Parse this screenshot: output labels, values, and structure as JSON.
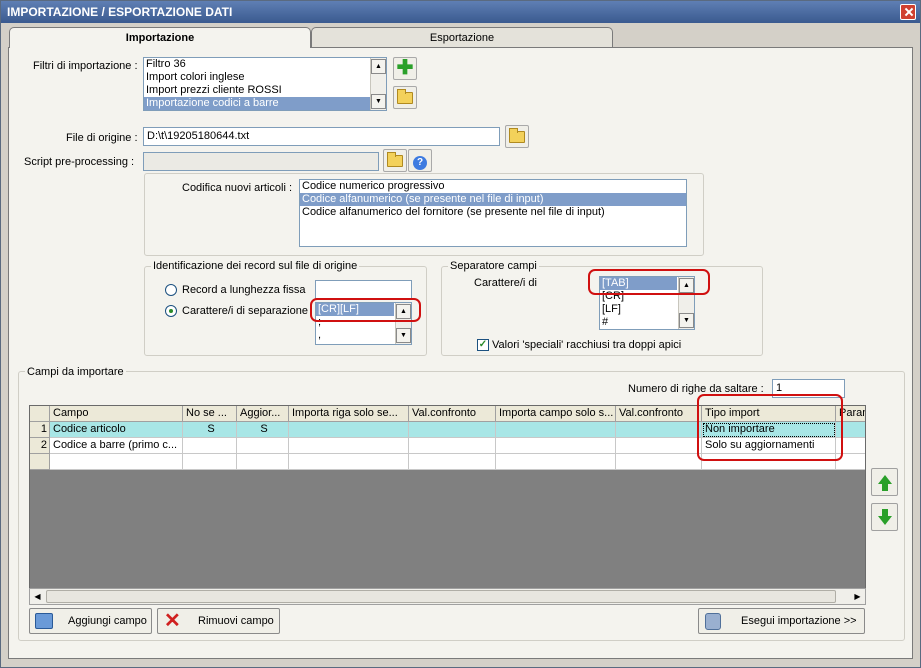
{
  "window": {
    "title": "IMPORTAZIONE / ESPORTAZIONE DATI"
  },
  "tabs": [
    {
      "label": "Importazione",
      "active": true
    },
    {
      "label": "Esportazione",
      "active": false
    }
  ],
  "filters": {
    "label": "Filtri di importazione :",
    "items": [
      "Filtro 36",
      "Import colori inglese",
      "Import prezzi cliente ROSSI",
      "Importazione codici a barre"
    ],
    "selected_index": 3
  },
  "source_file": {
    "label": "File di origine :",
    "value": "D:\\t\\19205180644.txt"
  },
  "script": {
    "label": "Script pre-processing :",
    "value": ""
  },
  "codifica": {
    "label": "Codifica nuovi articoli :",
    "items": [
      "Codice numerico progressivo",
      "Codice alfanumerico (se presente nel file di input)",
      "Codice alfanumerico del fornitore (se presente nel file di input)"
    ],
    "selected_index": 1
  },
  "identification": {
    "title": "Identificazione dei record sul file di origine",
    "option_fixed": "Record a lunghezza fissa",
    "option_sep": "Carattere/i di separazione",
    "selected": "sep",
    "sep_items": [
      "[CR][LF]",
      ";",
      ","
    ]
  },
  "separator": {
    "title": "Separatore campi",
    "label": "Carattere/i di",
    "items": [
      "[TAB]",
      "[CR]",
      "[LF]",
      "#"
    ],
    "quotes_label": "Valori 'speciali' racchiusi tra doppi apici",
    "quotes_checked": true
  },
  "fields": {
    "title": "Campi da importare",
    "skip_label": "Numero di righe da saltare :",
    "skip_value": "1",
    "columns": [
      "Campo",
      "No se ...",
      "Aggior...",
      "Importa riga solo se...",
      "Val.confronto",
      "Importa campo solo s...",
      "Val.confronto",
      "Tipo import",
      "Param"
    ],
    "rows": [
      {
        "num": "1",
        "campo": "Codice articolo",
        "nose": "S",
        "aggior": "S",
        "imprig": "",
        "val1": "",
        "impcamp": "",
        "val2": "",
        "tipo": "Non importare"
      },
      {
        "num": "2",
        "campo": "Codice a barre (primo c...",
        "nose": "",
        "aggior": "",
        "imprig": "",
        "val1": "",
        "impcamp": "",
        "val2": "",
        "tipo": "Solo su aggiornamenti"
      }
    ]
  },
  "buttons": {
    "add": "Aggiungi campo",
    "remove": "Rimuovi campo",
    "run": "Esegui importazione >>"
  }
}
